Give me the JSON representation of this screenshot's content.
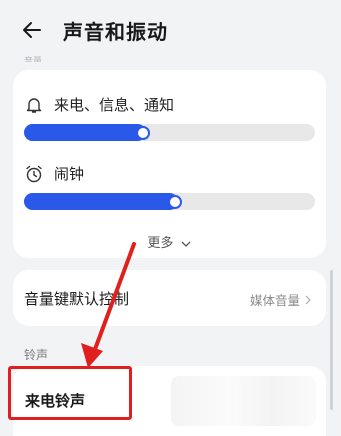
{
  "header": {
    "title": "声音和振动"
  },
  "partial_hidden_text": "音量",
  "volume": {
    "ringtone": {
      "label": "来电、信息、通知",
      "level": 0.42
    },
    "alarm": {
      "label": "闹钟",
      "level": 0.53
    },
    "more_label": "更多"
  },
  "volume_key": {
    "label": "音量键默认控制",
    "value": "媒体音量"
  },
  "ringtone_section": {
    "title": "铃声",
    "call_ringtone_label": "来电铃声"
  },
  "colors": {
    "accent": "#2a58e8",
    "annotation": "#e0201e"
  },
  "icons": [
    "back-arrow-icon",
    "bell-icon",
    "alarm-clock-icon",
    "chevron-down-icon",
    "chevron-right-icon"
  ]
}
